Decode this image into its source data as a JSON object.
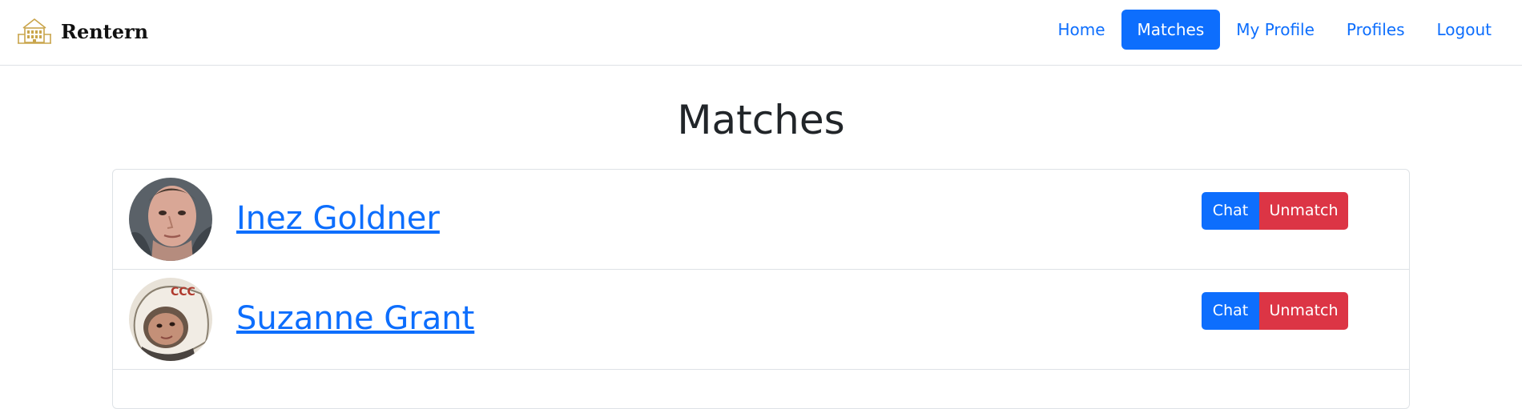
{
  "brand": {
    "name": "Rentern",
    "logo_icon": "building-icon",
    "logo_color": "#c9a54c"
  },
  "nav": {
    "items": [
      {
        "label": "Home",
        "active": false
      },
      {
        "label": "Matches",
        "active": true
      },
      {
        "label": "My Profile",
        "active": false
      },
      {
        "label": "Profiles",
        "active": false
      },
      {
        "label": "Logout",
        "active": false
      }
    ]
  },
  "page": {
    "title": "Matches"
  },
  "matches": [
    {
      "name": "Inez Goldner",
      "chat_label": "Chat",
      "unmatch_label": "Unmatch"
    },
    {
      "name": "Suzanne Grant",
      "chat_label": "Chat",
      "unmatch_label": "Unmatch"
    }
  ],
  "colors": {
    "primary": "#0d6efd",
    "danger": "#dc3545",
    "border": "#dee2e6"
  }
}
